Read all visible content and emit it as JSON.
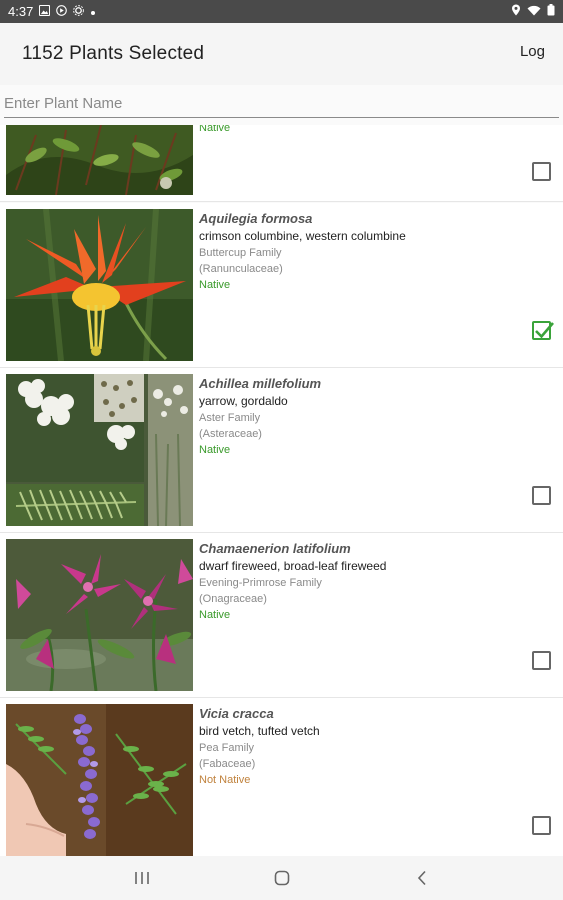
{
  "status_bar": {
    "time": "4:37",
    "left_icons": [
      "image-icon",
      "media-icon",
      "gear-icon",
      "notification-dot-icon"
    ],
    "right_icons": [
      "location-icon",
      "wifi-icon",
      "battery-icon"
    ]
  },
  "app_bar": {
    "title": "1152 Plants Selected",
    "log_label": "Log"
  },
  "search": {
    "placeholder": "Enter Plant Name",
    "value": ""
  },
  "plants": [
    {
      "scientific": "",
      "common": "",
      "family": "",
      "family_latin": "",
      "status": "Native",
      "checked": false
    },
    {
      "scientific": "Aquilegia formosa",
      "common": "crimson columbine, western columbine",
      "family": "Buttercup Family",
      "family_latin": "(Ranunculaceae)",
      "status": "Native",
      "checked": true
    },
    {
      "scientific": "Achillea millefolium",
      "common": "yarrow, gordaldo",
      "family": "Aster Family",
      "family_latin": "(Asteraceae)",
      "status": "Native",
      "checked": false
    },
    {
      "scientific": "Chamaenerion latifolium",
      "common": "dwarf fireweed, broad-leaf fireweed",
      "family": "Evening-Primrose Family",
      "family_latin": "(Onagraceae)",
      "status": "Native",
      "checked": false
    },
    {
      "scientific": "Vicia cracca",
      "common": "bird vetch, tufted vetch",
      "family": "Pea Family",
      "family_latin": "(Fabaceae)",
      "status": "Not Native",
      "checked": false
    }
  ],
  "colors": {
    "native": "#3a9a2b",
    "not_native": "#c0823d",
    "checked": "#3aa33a",
    "status_bar": "#4a4a4a"
  },
  "nav": [
    "recent-apps-icon",
    "home-icon",
    "back-icon"
  ]
}
